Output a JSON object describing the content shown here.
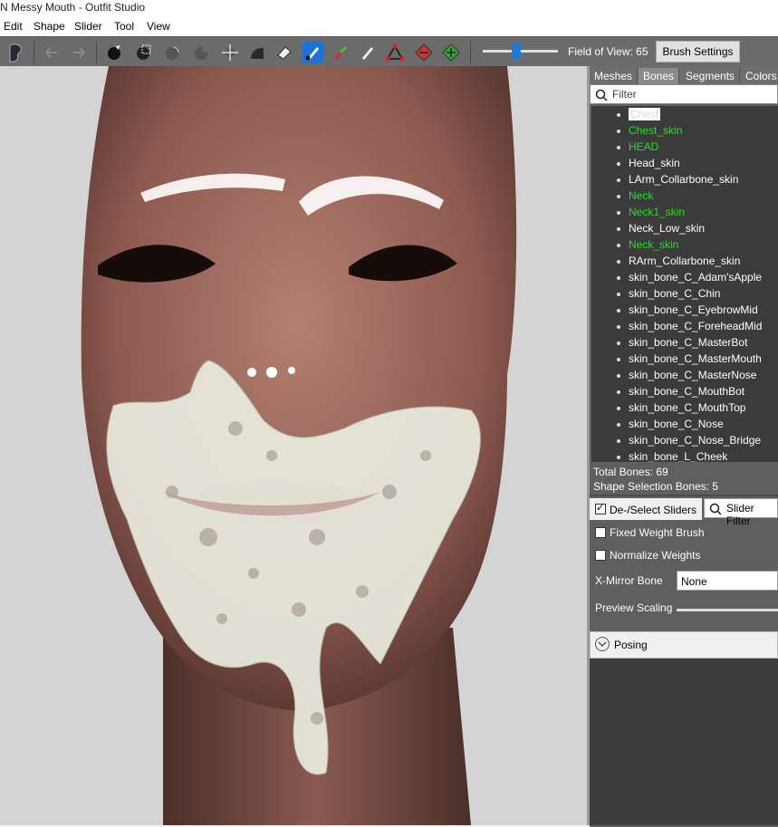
{
  "window": {
    "title": "N Messy Mouth - Outfit Studio"
  },
  "menu": [
    "Edit",
    "Shape",
    "Slider",
    "Tool",
    "View"
  ],
  "toolbar": {
    "icons": [
      "logo-icon",
      "undo-icon",
      "redo-icon",
      "brush-icon",
      "select-icon",
      "inflate-icon",
      "deflate-icon",
      "move-icon",
      "smooth-icon",
      "eraser-icon",
      "mask-icon",
      "weight-icon",
      "paint-icon",
      "transform-icon",
      "collapse-icon",
      "expand-icon"
    ],
    "fov_label": "Field of View: 65",
    "fov_value": 65,
    "brush_settings_label": "Brush Settings"
  },
  "panel": {
    "tabs": [
      "Meshes",
      "Bones",
      "Segments",
      "Colors"
    ],
    "active_tab": "Bones",
    "filter_placeholder": "Filter",
    "bones": [
      {
        "name": "Chest",
        "color": "#ffffff",
        "selected": true
      },
      {
        "name": "Chest_skin",
        "color": "#22e022"
      },
      {
        "name": "HEAD",
        "color": "#22e022"
      },
      {
        "name": "Head_skin",
        "color": "#ffffff"
      },
      {
        "name": "LArm_Collarbone_skin",
        "color": "#ffffff"
      },
      {
        "name": "Neck",
        "color": "#22e022"
      },
      {
        "name": "Neck1_skin",
        "color": "#22e022"
      },
      {
        "name": "Neck_Low_skin",
        "color": "#ffffff"
      },
      {
        "name": "Neck_skin",
        "color": "#22e022"
      },
      {
        "name": "RArm_Collarbone_skin",
        "color": "#ffffff"
      },
      {
        "name": "skin_bone_C_Adam'sApple",
        "color": "#ffffff"
      },
      {
        "name": "skin_bone_C_Chin",
        "color": "#ffffff"
      },
      {
        "name": "skin_bone_C_EyebrowMid",
        "color": "#ffffff"
      },
      {
        "name": "skin_bone_C_ForeheadMid",
        "color": "#ffffff"
      },
      {
        "name": "skin_bone_C_MasterBot",
        "color": "#ffffff"
      },
      {
        "name": "skin_bone_C_MasterMouth",
        "color": "#ffffff"
      },
      {
        "name": "skin_bone_C_MasterNose",
        "color": "#ffffff"
      },
      {
        "name": "skin_bone_C_MouthBot",
        "color": "#ffffff"
      },
      {
        "name": "skin_bone_C_MouthTop",
        "color": "#ffffff"
      },
      {
        "name": "skin_bone_C_Nose",
        "color": "#ffffff"
      },
      {
        "name": "skin_bone_C_Nose_Bridge",
        "color": "#ffffff"
      },
      {
        "name": "skin_bone_L_Cheek",
        "color": "#ffffff"
      }
    ],
    "total_bones": "Total Bones: 69",
    "shape_selection_bones": "Shape Selection Bones: 5",
    "deselect_sliders": "De-/Select Sliders",
    "slider_filter": "Slider Filter",
    "fixed_weight_brush": "Fixed Weight Brush",
    "normalize_weights": "Normalize Weights",
    "x_mirror_bone": "X-Mirror Bone",
    "x_mirror_value": "None",
    "preview_scaling": "Preview Scaling",
    "posing": "Posing"
  },
  "viewport": {
    "description": "3D head mesh render"
  }
}
